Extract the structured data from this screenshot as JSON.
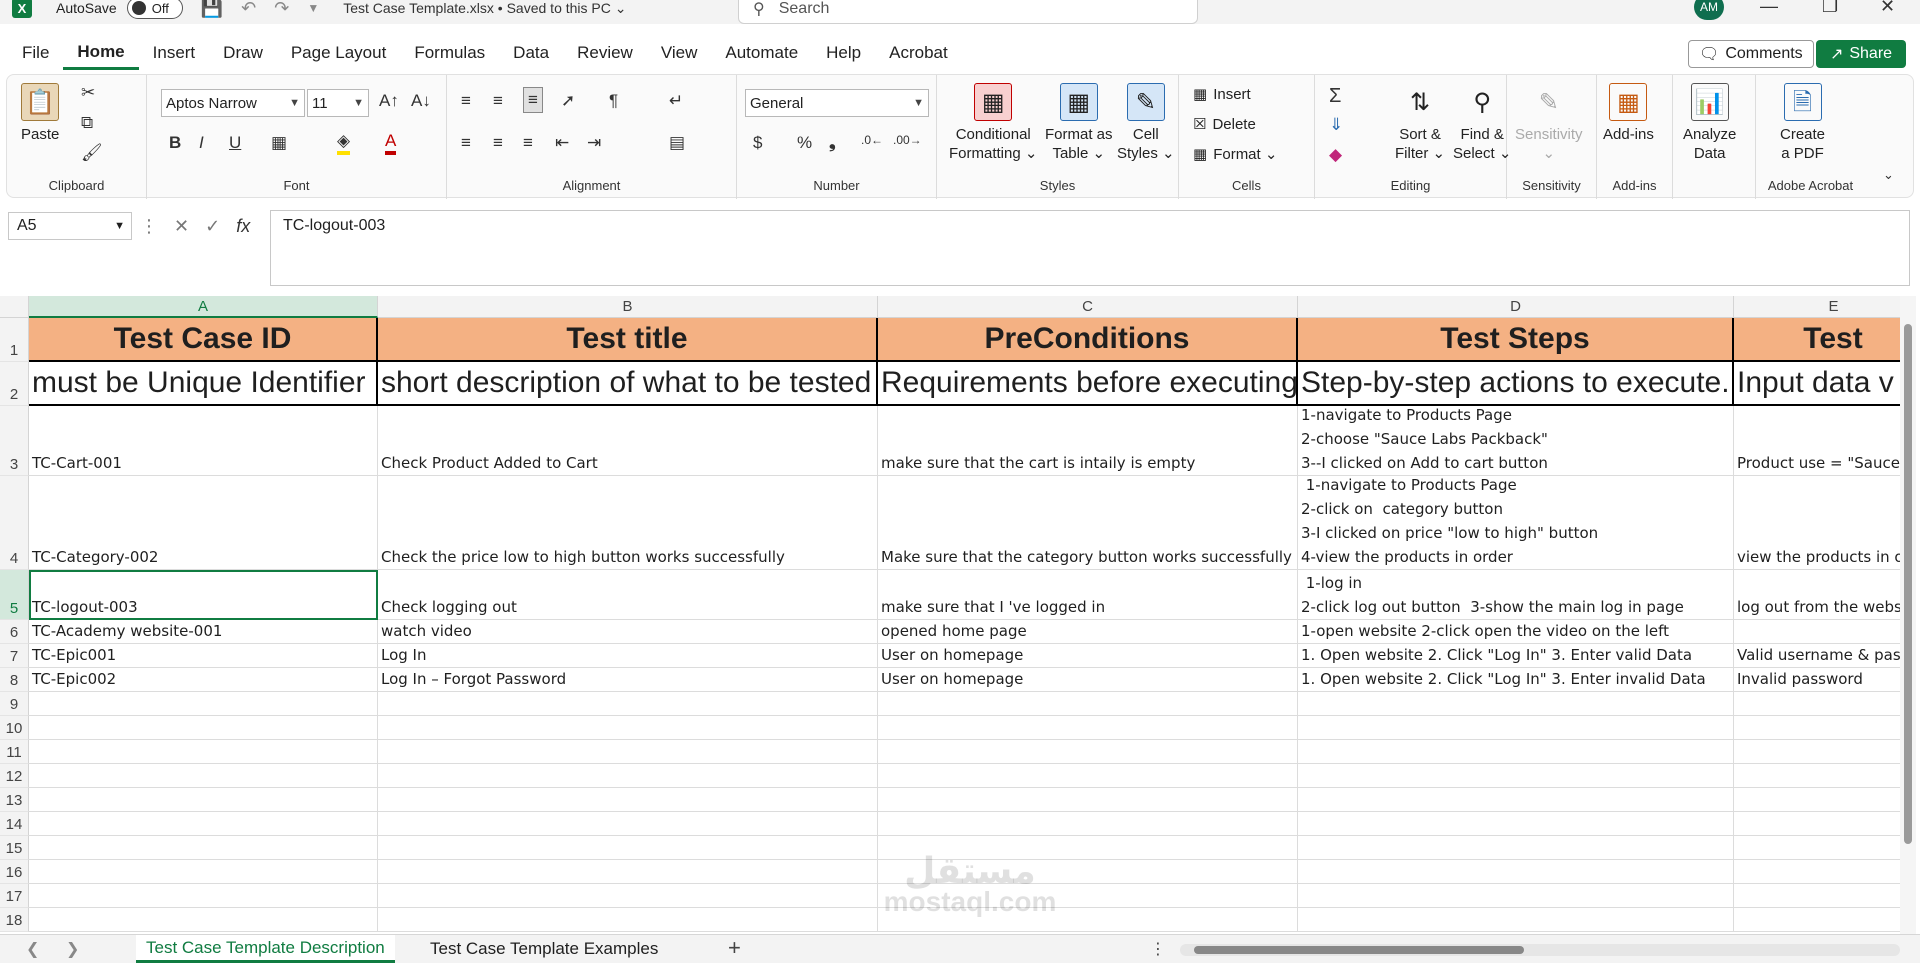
{
  "titlebar": {
    "app_icon": "X",
    "autosave_label": "AutoSave",
    "autosave_state": "Off",
    "doc_title": "Test Case Template.xlsx • Saved to this PC ⌄",
    "search_placeholder": "Search",
    "avatar_initials": "AM"
  },
  "tabs": [
    "File",
    "Home",
    "Insert",
    "Draw",
    "Page Layout",
    "Formulas",
    "Data",
    "Review",
    "View",
    "Automate",
    "Help",
    "Acrobat"
  ],
  "active_tab": "Home",
  "comments_label": "Comments",
  "share_label": "Share",
  "ribbon": {
    "clipboard": {
      "label": "Clipboard",
      "paste": "Paste"
    },
    "font": {
      "label": "Font",
      "name": "Aptos Narrow",
      "size": "11",
      "bold": "B",
      "italic": "I",
      "underline": "U"
    },
    "alignment": {
      "label": "Alignment"
    },
    "number": {
      "label": "Number",
      "format": "General",
      "currency": "$",
      "percent": "%",
      "comma": "❟"
    },
    "styles": {
      "label": "Styles",
      "conditional": "Conditional\nFormatting ⌄",
      "format_table": "Format as\nTable ⌄",
      "cell_styles": "Cell\nStyles ⌄"
    },
    "cells": {
      "label": "Cells",
      "insert": "Insert",
      "delete": "Delete",
      "format": "Format ⌄"
    },
    "editing": {
      "label": "Editing",
      "sort": "Sort &\nFilter ⌄",
      "find": "Find &\nSelect ⌄"
    },
    "sensitivity": {
      "label": "Sensitivity",
      "btn": "Sensitivity\n⌄"
    },
    "addins": {
      "label": "Add-ins",
      "btn": "Add-ins"
    },
    "analyze": {
      "btn": "Analyze\nData"
    },
    "acrobat": {
      "label": "Adobe Acrobat",
      "btn": "Create\na PDF"
    }
  },
  "formula_bar": {
    "name_box": "A5",
    "fx": "fx",
    "content": "TC-logout-003"
  },
  "columns": [
    {
      "letter": "A"
    },
    {
      "letter": "B"
    },
    {
      "letter": "C"
    },
    {
      "letter": "D"
    },
    {
      "letter": "E"
    }
  ],
  "rows": [
    {
      "num": "1",
      "cells": [
        "Test Case ID",
        "Test title",
        "PreConditions",
        "Test Steps",
        "Test"
      ]
    },
    {
      "num": "2",
      "cells": [
        "must be Unique Identifier",
        "short description of what to be tested",
        "Requirements before executing",
        "Step-by-step actions to execute.",
        "Input data v"
      ]
    },
    {
      "num": "3",
      "cells": [
        "TC-Cart-001",
        "Check Product Added to Cart",
        "make sure that the cart is intaily is empty\n",
        "1-navigate to Products Page\n2-choose \"Sauce Labs Packback\"\n3--I clicked on Add to cart button",
        "Product use = \"Sauce"
      ]
    },
    {
      "num": "4",
      "cells": [
        "TC-Category-002",
        "Check the price low to high button works successfully",
        "Make sure that the category button works successfully\n",
        " 1-navigate to Products Page\n2-click on  category button\n3-I clicked on price \"low to high\" button\n4-view the products in order",
        "view the products in or"
      ]
    },
    {
      "num": "5",
      "cells": [
        "TC-logout-003",
        "Check logging out",
        "make sure that I 've logged in",
        " 1-log in\n2-click log out button  3-show the main log in page",
        "log out from the websi"
      ]
    },
    {
      "num": "6",
      "cells": [
        "TC-Academy website-001",
        "watch video",
        "opened home page",
        "1-open website 2-click open the video on the left",
        ""
      ]
    },
    {
      "num": "7",
      "cells": [
        "TC-Epic001",
        "Log In",
        "User on homepage",
        "1. Open website 2. Click \"Log In\" 3. Enter valid Data",
        "Valid username & pas"
      ]
    },
    {
      "num": "8",
      "cells": [
        "TC-Epic002",
        "Log In – Forgot Password",
        "User on homepage",
        "1. Open website 2. Click \"Log In\" 3. Enter invalid Data",
        "Invalid password"
      ]
    },
    {
      "num": "9",
      "cells": [
        "",
        "",
        "",
        "",
        ""
      ]
    },
    {
      "num": "10",
      "cells": [
        "",
        "",
        "",
        "",
        ""
      ]
    },
    {
      "num": "11",
      "cells": [
        "",
        "",
        "",
        "",
        ""
      ]
    },
    {
      "num": "12",
      "cells": [
        "",
        "",
        "",
        "",
        ""
      ]
    },
    {
      "num": "13",
      "cells": [
        "",
        "",
        "",
        "",
        ""
      ]
    },
    {
      "num": "14",
      "cells": [
        "",
        "",
        "",
        "",
        ""
      ]
    },
    {
      "num": "15",
      "cells": [
        "",
        "",
        "",
        "",
        ""
      ]
    },
    {
      "num": "16",
      "cells": [
        "",
        "",
        "",
        "",
        ""
      ]
    },
    {
      "num": "17",
      "cells": [
        "",
        "",
        "",
        "",
        ""
      ]
    },
    {
      "num": "18",
      "cells": [
        "",
        "",
        "",
        "",
        ""
      ]
    }
  ],
  "active_cell": "A5",
  "sheets": [
    "Test Case Template Description",
    "Test Case Template Examples"
  ],
  "active_sheet": "Test Case Template Description",
  "watermark": {
    "arabic": "مستقل",
    "latin": "mostaql.com"
  },
  "colors": {
    "accent": "#107c41",
    "header_fill": "#f4b183"
  }
}
